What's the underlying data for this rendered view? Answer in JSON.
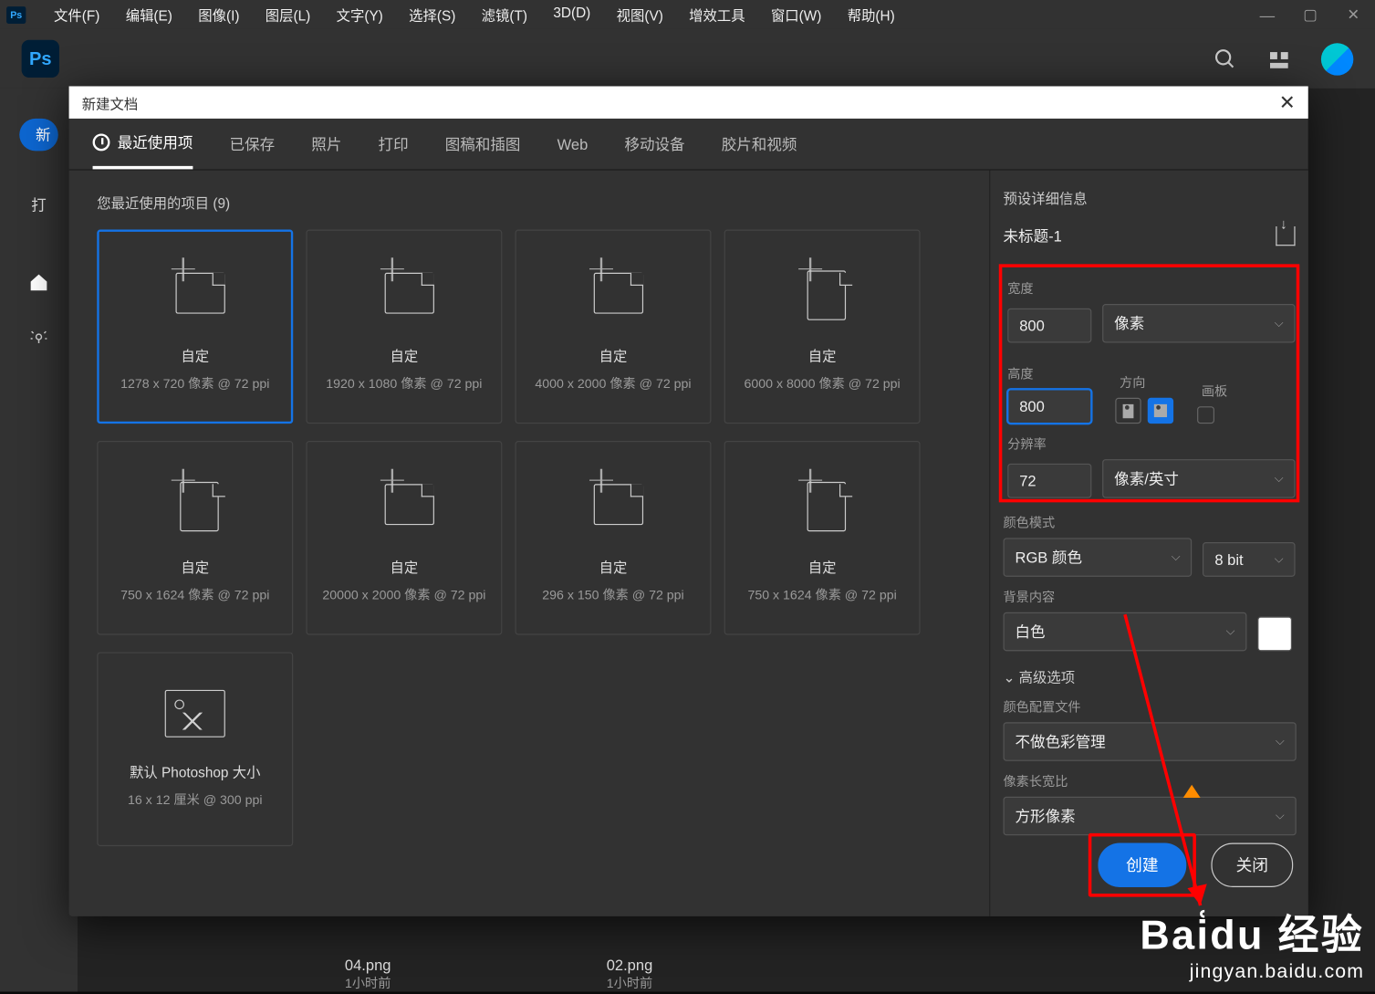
{
  "menubar": [
    "文件(F)",
    "编辑(E)",
    "图像(I)",
    "图层(L)",
    "文字(Y)",
    "选择(S)",
    "滤镜(T)",
    "3D(D)",
    "视图(V)",
    "增效工具",
    "窗口(W)",
    "帮助(H)"
  ],
  "left_pill": "新",
  "left_pad": "打",
  "dialog": {
    "title": "新建文档",
    "tabs": [
      "最近使用项",
      "已保存",
      "照片",
      "打印",
      "图稿和插图",
      "Web",
      "移动设备",
      "胶片和视频"
    ],
    "recent_label": "您最近使用的项目  (9)",
    "presets": [
      {
        "title": "自定",
        "sub": "1278 x 720 像素 @ 72 ppi",
        "shape": "land",
        "sel": true
      },
      {
        "title": "自定",
        "sub": "1920 x 1080 像素 @ 72 ppi",
        "shape": "land"
      },
      {
        "title": "自定",
        "sub": "4000 x 2000 像素 @ 72 ppi",
        "shape": "land"
      },
      {
        "title": "自定",
        "sub": "6000 x 8000 像素 @ 72 ppi",
        "shape": "port"
      },
      {
        "title": "自定",
        "sub": "750 x 1624 像素 @ 72 ppi",
        "shape": "port"
      },
      {
        "title": "自定",
        "sub": "20000 x 2000 像素 @ 72 ppi",
        "shape": "land"
      },
      {
        "title": "自定",
        "sub": "296 x 150 像素 @ 72 ppi",
        "shape": "land"
      },
      {
        "title": "自定",
        "sub": "750 x 1624 像素 @ 72 ppi",
        "shape": "port"
      },
      {
        "title": "默认 Photoshop 大小",
        "sub": "16 x 12 厘米 @ 300 ppi",
        "shape": "img"
      }
    ],
    "details": {
      "head": "预设详细信息",
      "filename": "未标题-1",
      "width_label": "宽度",
      "width_value": "800",
      "unit": "像素",
      "height_label": "高度",
      "height_value": "800",
      "orient_label": "方向",
      "artboard_label": "画板",
      "res_label": "分辨率",
      "res_value": "72",
      "res_unit": "像素/英寸",
      "color_mode_label": "颜色模式",
      "color_mode": "RGB 颜色",
      "bit": "8 bit",
      "bg_label": "背景内容",
      "bg": "白色",
      "adv": "高级选项",
      "profile_label": "颜色配置文件",
      "profile": "不做色彩管理",
      "aspect_label": "像素长宽比",
      "aspect": "方形像素",
      "create": "创建",
      "close": "关闭"
    }
  },
  "bottom_files": [
    {
      "name": "04.png",
      "time": "1小时前"
    },
    {
      "name": "02.png",
      "time": "1小时前"
    }
  ],
  "watermark": {
    "big": "Bai͑du 经验",
    "sub": "jingyan.baidu.com"
  }
}
